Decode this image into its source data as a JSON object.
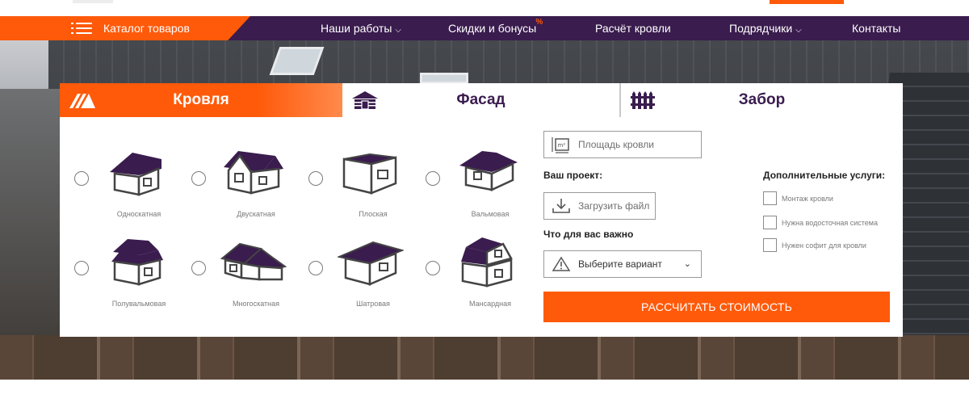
{
  "nav": {
    "catalog_label": "Каталог товаров",
    "items": [
      {
        "label": "Наши работы",
        "has_dropdown": true
      },
      {
        "label": "Скидки и бонусы",
        "badge": "%"
      },
      {
        "label": "Расчёт кровли",
        "has_dropdown": false
      },
      {
        "label": "Подрядчики",
        "has_dropdown": true
      },
      {
        "label": "Контакты",
        "has_dropdown": false
      }
    ],
    "chevron": "⌄"
  },
  "tabs": [
    {
      "label": "Кровля",
      "icon": "roof-icon",
      "active": true
    },
    {
      "label": "Фасад",
      "icon": "house-siding-icon",
      "active": false
    },
    {
      "label": "Забор",
      "icon": "fence-icon",
      "active": false
    }
  ],
  "roof_types": [
    {
      "label": "Односкатная",
      "shape": "single-pitch"
    },
    {
      "label": "Двускатная",
      "shape": "gable"
    },
    {
      "label": "Плоская",
      "shape": "flat"
    },
    {
      "label": "Вальмовая",
      "shape": "hip"
    },
    {
      "label": "Полувальмовая",
      "shape": "half-hip"
    },
    {
      "label": "Многоскатная",
      "shape": "multi-pitch"
    },
    {
      "label": "Шатровая",
      "shape": "tent"
    },
    {
      "label": "Мансардная",
      "shape": "mansard"
    }
  ],
  "form": {
    "area_placeholder": "Площадь кровли",
    "project_label": "Ваш проект:",
    "upload_label": "Загрузить файл",
    "important_label": "Что для вас важно",
    "select_value": "Выберите вариант",
    "extra_label": "Дополнительные услуги:",
    "extras": [
      {
        "label": "Монтаж кровли",
        "checked": false
      },
      {
        "label": "Нужна водосточная система",
        "checked": false
      },
      {
        "label": "Нужен софит для кровли",
        "checked": false
      }
    ],
    "submit_label": "РАССЧИТАТЬ СТОИМОСТЬ"
  },
  "colors": {
    "accent": "#ff5a0a",
    "nav_bg": "#3a1c4e",
    "roof_fill": "#3a1c4e"
  }
}
